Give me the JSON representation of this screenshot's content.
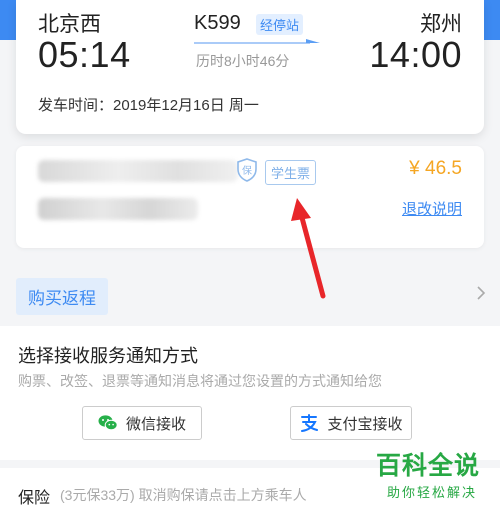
{
  "train": {
    "from_station": "北京西",
    "to_station": "郑州",
    "train_no": "K599",
    "stops_label": "经停站",
    "depart_time": "05:14",
    "arrive_time": "14:00",
    "duration": "历时8小时46分",
    "depart_line": "发车时间：2019年12月16日 周一"
  },
  "passenger": {
    "student_badge": "学生票",
    "price": "¥ 46.5",
    "refund_link": "退改说明"
  },
  "return_trip": {
    "label": "购买返程"
  },
  "notify": {
    "title": "选择接收服务通知方式",
    "description": "购票、改签、退票等通知消息将通过您设置的方式通知给您",
    "wechat_label": "微信接收",
    "alipay_label": "支付宝接收"
  },
  "insurance": {
    "label": "保险",
    "description": "(3元保33万) 取消购保请点击上方乘车人"
  },
  "watermark": {
    "title": "百科全说",
    "subtitle": "助你轻松解决"
  },
  "colors": {
    "accent_blue": "#3d8af2",
    "price_orange": "#f5a623",
    "annotation_red": "#e8262a",
    "watermark_green": "#27a844"
  },
  "icons": [
    "insurance-shield-icon",
    "arrow-right-icon",
    "chevron-right-icon",
    "wechat-icon",
    "alipay-icon"
  ]
}
